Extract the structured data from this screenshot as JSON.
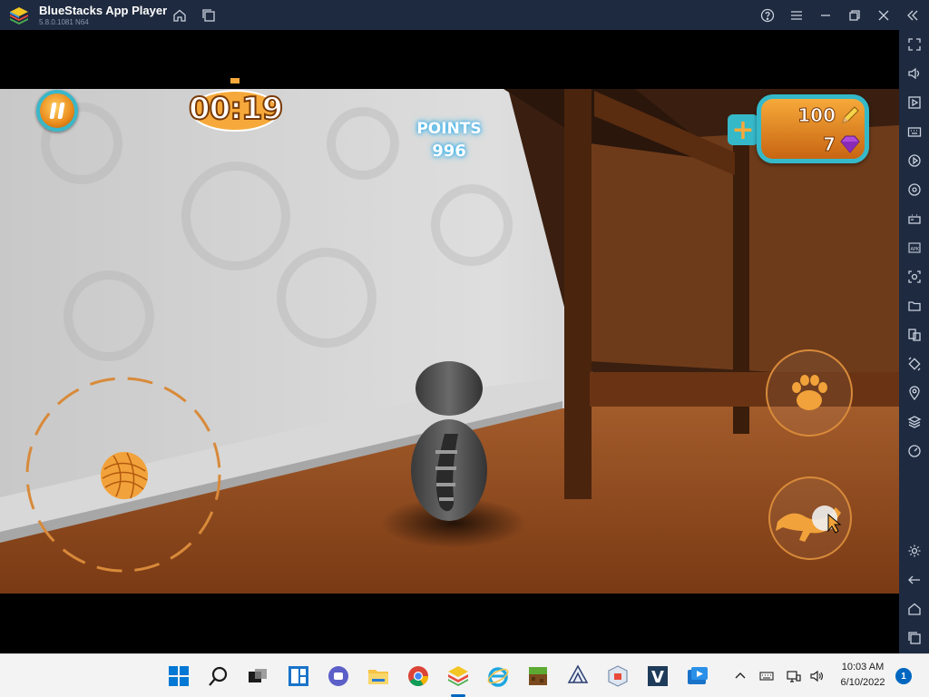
{
  "window": {
    "title": "BlueStacks App Player",
    "version": "5.8.0.1081 N64"
  },
  "titlebar_icons": [
    "home-icon",
    "multi-instance-icon",
    "help-icon",
    "menu-icon",
    "minimize-icon",
    "restore-icon",
    "close-icon",
    "collapse-sidebar-icon"
  ],
  "sidebar_icons": [
    "fullscreen-icon",
    "volume-icon",
    "media-manager-icon",
    "keyboard-controls-icon",
    "macro-icon",
    "rotate-icon",
    "gamepad-icon",
    "install-apk-icon",
    "screenshot-icon",
    "folder-icon",
    "multi-instance-icon",
    "shake-icon",
    "location-icon",
    "layers-icon",
    "eco-mode-icon",
    "settings-icon",
    "back-icon",
    "home-icon",
    "recent-apps-icon"
  ],
  "game": {
    "hud": {
      "timer": "00:19",
      "points_label": "POINTS",
      "points_value": "996",
      "coins": "100",
      "gems": "7",
      "plus": "+"
    },
    "controls": [
      "joystick",
      "paw-attack-button",
      "jump-button"
    ]
  },
  "taskbar": {
    "apps": [
      "start-icon",
      "search-icon",
      "task-view-icon",
      "widgets-icon",
      "teams-chat-icon",
      "file-explorer-icon",
      "chrome-icon",
      "bluestacks-icon",
      "internet-explorer-icon",
      "minecraft-icon",
      "inkscape-icon",
      "virtualbox-icon",
      "v-app-icon",
      "media-player-icon"
    ],
    "active_app": "bluestacks-icon",
    "clock_time": "10:03 AM",
    "clock_date": "6/10/2022",
    "notifications": "1"
  },
  "colors": {
    "chrome_bg": "#1e2a3f",
    "hud_orange": "#f6a93a",
    "hud_teal": "#35b9c9",
    "taskbar_bg": "#f3f3f3",
    "accent_blue": "#0067c0"
  }
}
